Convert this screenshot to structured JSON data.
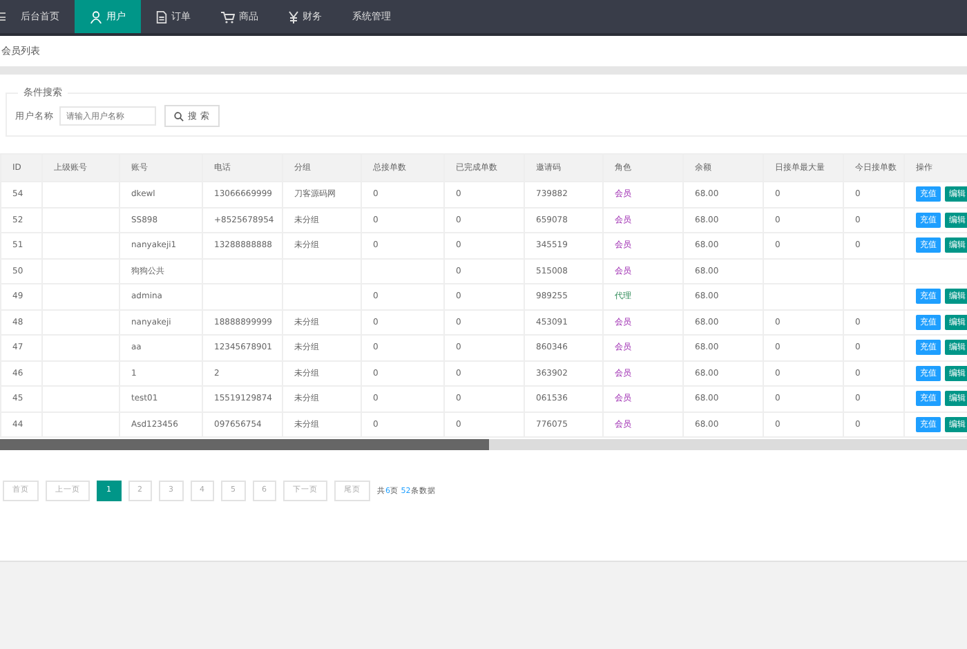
{
  "nav": [
    {
      "label": "后台首页",
      "kind": "plain",
      "selected": false
    },
    {
      "label": "用户",
      "kind": "user",
      "selected": true
    },
    {
      "label": "订单",
      "kind": "doc",
      "selected": false
    },
    {
      "label": "商品",
      "kind": "cart",
      "selected": false
    },
    {
      "label": "财务",
      "kind": "yen",
      "selected": false
    },
    {
      "label": "系统管理",
      "kind": "plain",
      "selected": false
    }
  ],
  "breadcrumb": "会员列表",
  "search": {
    "legend": "条件搜索",
    "label": "用户名称",
    "placeholder": "请输入用户名称",
    "button": "搜 索"
  },
  "table": {
    "columns": [
      "ID",
      "上级账号",
      "账号",
      "电话",
      "分组",
      "总接单数",
      "已完成单数",
      "邀请码",
      "角色",
      "余额",
      "日接单最大量",
      "今日接单数",
      "操作"
    ],
    "rows": [
      {
        "id": "54",
        "account": "dkewl",
        "phone": "13066669999",
        "group": "刀客源码网",
        "total": "0",
        "done": "0",
        "code": "739882",
        "role": {
          "text": "会员",
          "kind": "member"
        },
        "balance": "68.00",
        "max": "0",
        "today": "0",
        "actions": [
          "充值",
          "编辑"
        ]
      },
      {
        "id": "52",
        "account": "SS898",
        "phone": "+8525678954",
        "group": "未分组",
        "total": "0",
        "done": "0",
        "code": "659078",
        "role": {
          "text": "会员",
          "kind": "member"
        },
        "balance": "68.00",
        "max": "0",
        "today": "0",
        "actions": [
          "充值",
          "编辑"
        ]
      },
      {
        "id": "51",
        "account": "nanyakeji1",
        "phone": "13288888888",
        "group": "未分组",
        "total": "0",
        "done": "0",
        "code": "345519",
        "role": {
          "text": "会员",
          "kind": "member"
        },
        "balance": "68.00",
        "max": "0",
        "today": "0",
        "actions": [
          "充值",
          "编辑"
        ]
      },
      {
        "id": "50",
        "account": "狗狗公共",
        "done": "0",
        "code": "515008",
        "role": {
          "text": "会员",
          "kind": "member"
        },
        "balance": "68.00"
      },
      {
        "id": "49",
        "account": "admina",
        "total": "0",
        "done": "0",
        "code": "989255",
        "role": {
          "text": "代理",
          "kind": "agent"
        },
        "balance": "68.00",
        "actions": [
          "充值",
          "编辑"
        ]
      },
      {
        "id": "48",
        "account": "nanyakeji",
        "phone": "18888899999",
        "group": "未分组",
        "total": "0",
        "done": "0",
        "code": "453091",
        "role": {
          "text": "会员",
          "kind": "member"
        },
        "balance": "68.00",
        "max": "0",
        "today": "0",
        "actions": [
          "充值",
          "编辑"
        ]
      },
      {
        "id": "47",
        "account": "aa",
        "phone": "12345678901",
        "group": "未分组",
        "total": "0",
        "done": "0",
        "code": "860346",
        "role": {
          "text": "会员",
          "kind": "member"
        },
        "balance": "68.00",
        "max": "0",
        "today": "0",
        "actions": [
          "充值",
          "编辑"
        ]
      },
      {
        "id": "46",
        "account": "1",
        "phone": "2",
        "group": "未分组",
        "total": "0",
        "done": "0",
        "code": "363902",
        "role": {
          "text": "会员",
          "kind": "member"
        },
        "balance": "68.00",
        "max": "0",
        "today": "0",
        "actions": [
          "充值",
          "编辑"
        ]
      },
      {
        "id": "45",
        "account": "test01",
        "phone": "15519129874",
        "group": "未分组",
        "total": "0",
        "done": "0",
        "code": "061536",
        "role": {
          "text": "会员",
          "kind": "member"
        },
        "balance": "68.00",
        "max": "0",
        "today": "0",
        "actions": [
          "充值",
          "编辑"
        ]
      },
      {
        "id": "44",
        "account": "Asd123456",
        "phone": "097656754",
        "group": "未分组",
        "total": "0",
        "done": "0",
        "code": "776075",
        "role": {
          "text": "会员",
          "kind": "member"
        },
        "balance": "68.00",
        "max": "0",
        "today": "0",
        "actions": [
          "充值",
          "编辑"
        ]
      }
    ]
  },
  "pagination": {
    "items": [
      {
        "label": "首页",
        "selected": false
      },
      {
        "label": "上一页",
        "selected": false
      },
      {
        "label": "1",
        "selected": true
      },
      {
        "label": "2",
        "selected": false
      },
      {
        "label": "3",
        "selected": false
      },
      {
        "label": "4",
        "selected": false
      },
      {
        "label": "5",
        "selected": false
      },
      {
        "label": "6",
        "selected": false
      },
      {
        "label": "下一页",
        "selected": false
      },
      {
        "label": "尾页",
        "selected": false
      }
    ],
    "summary": "共**6**页 **52**条数据"
  }
}
